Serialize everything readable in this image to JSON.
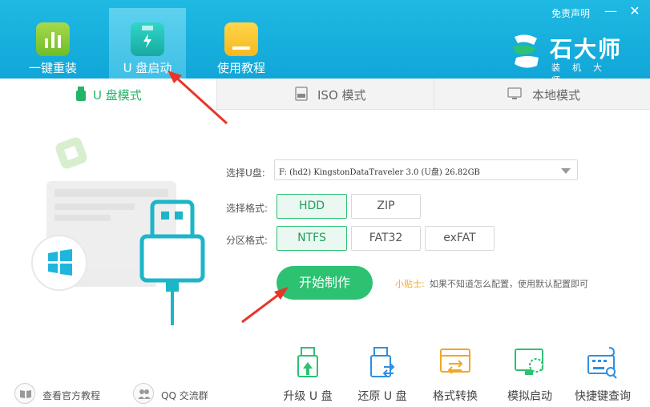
{
  "header": {
    "nav": [
      {
        "label": "一键重装",
        "icon": "bar-chart-icon"
      },
      {
        "label": "U 盘启动",
        "icon": "usb-flash-icon"
      },
      {
        "label": "使用教程",
        "icon": "book-icon"
      }
    ],
    "disclaimer_label": "免责声明",
    "minimize_label": "—",
    "close_label": "✕",
    "brand": {
      "name": "石大师",
      "subtitle": "装机大师"
    }
  },
  "mode_tabs": [
    {
      "label": "U 盘模式",
      "icon": "usb-drive-icon",
      "active": true
    },
    {
      "label": "ISO 模式",
      "icon": "iso-file-icon",
      "active": false
    },
    {
      "label": "本地模式",
      "icon": "monitor-icon",
      "active": false
    }
  ],
  "form": {
    "usb_label": "选择U盘:",
    "usb_value": "F: (hd2) KingstonDataTraveler 3.0 (U盘) 26.82GB",
    "format_label": "选择格式:",
    "format_options": [
      "HDD",
      "ZIP"
    ],
    "format_selected": "HDD",
    "partition_label": "分区格式:",
    "partition_options": [
      "NTFS",
      "FAT32",
      "exFAT"
    ],
    "partition_selected": "NTFS",
    "start_button": "开始制作",
    "tip_key": "小贴士:",
    "tip_text": "如果不知道怎么配置，使用默认配置即可"
  },
  "bottom_links": [
    {
      "label": "查看官方教程",
      "icon": "book-open-icon"
    },
    {
      "label": "QQ 交流群",
      "icon": "qq-group-icon"
    }
  ],
  "tools": [
    {
      "label": "升级 U 盘",
      "icon": "usb-upgrade-icon"
    },
    {
      "label": "还原 U 盘",
      "icon": "usb-restore-icon"
    },
    {
      "label": "格式转换",
      "icon": "format-convert-icon"
    },
    {
      "label": "模拟启动",
      "icon": "simulate-boot-icon"
    },
    {
      "label": "快捷键查询",
      "icon": "keyboard-search-icon"
    }
  ],
  "colors": {
    "header": "#13a9da",
    "accent_green": "#2dc172",
    "tip_orange": "#f5a623",
    "arrow_red": "#e8352a"
  }
}
